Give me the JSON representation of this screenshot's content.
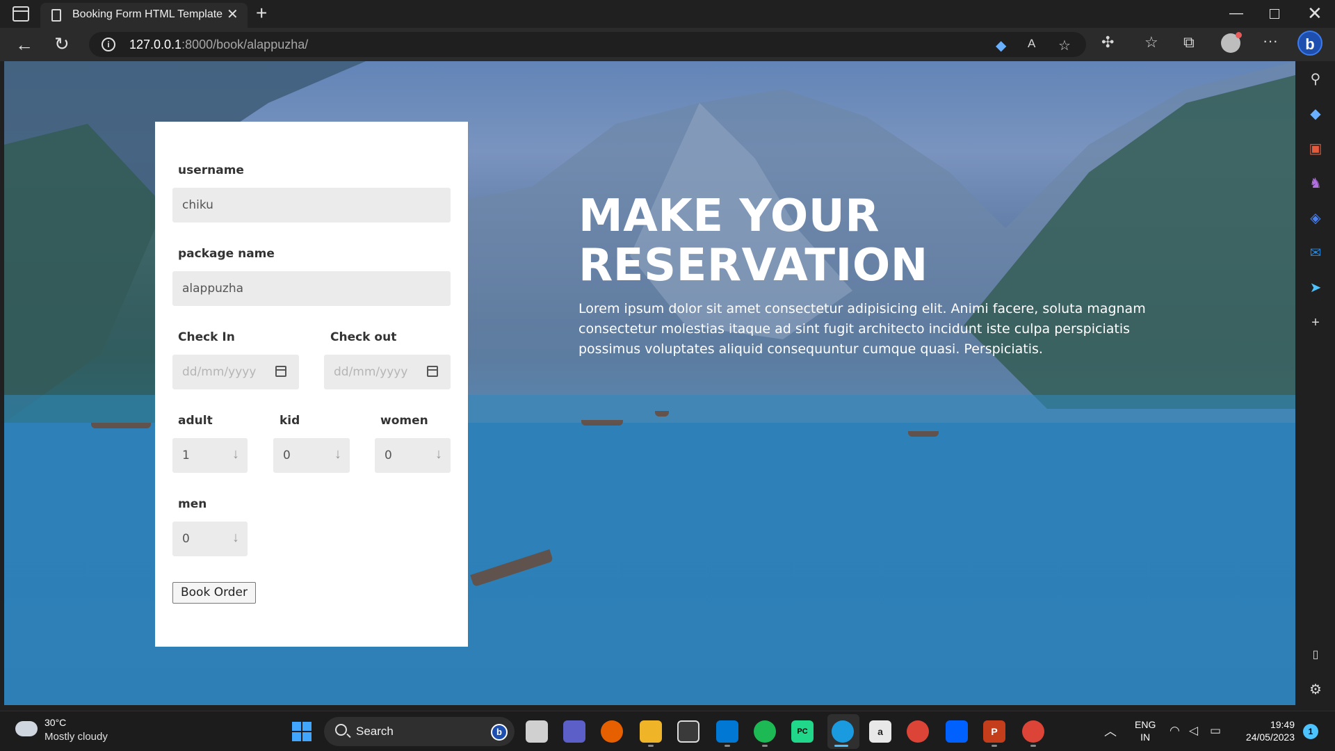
{
  "browser": {
    "tab_title": "Booking Form HTML Template",
    "url_host": "127.0.0.1",
    "url_path": ":8000/book/alappuzha/"
  },
  "form": {
    "username_label": "username",
    "username_value": "chiku",
    "package_label": "package name",
    "package_value": "alappuzha",
    "checkin_label": "Check In",
    "checkin_placeholder": "dd/mm/yyyy",
    "checkout_label": "Check out",
    "checkout_placeholder": "dd/mm/yyyy",
    "adult_label": "adult",
    "adult_value": "1",
    "kid_label": "kid",
    "kid_value": "0",
    "women_label": "women",
    "women_value": "0",
    "men_label": "men",
    "men_value": "0",
    "submit_label": "Book Order"
  },
  "hero": {
    "title_line1": "MAKE YOUR",
    "title_line2": "RESERVATION",
    "text": "Lorem ipsum dolor sit amet consectetur adipisicing elit. Animi facere, soluta magnam consectetur molestias itaque ad sint fugit architecto incidunt iste culpa perspiciatis possimus voluptates aliquid consequuntur cumque quasi. Perspiciatis."
  },
  "taskbar": {
    "weather_temp": "30°C",
    "weather_desc": "Mostly cloudy",
    "search_label": "Search",
    "lang_line1": "ENG",
    "lang_line2": "IN",
    "time": "19:49",
    "date": "24/05/2023",
    "notification_count": "1"
  }
}
